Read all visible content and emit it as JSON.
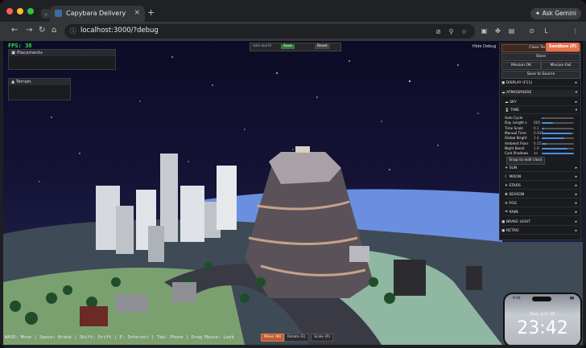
{
  "browser": {
    "tab_title": "Capybara Delivery",
    "url": "localhost:3000/?debug",
    "ask_gemini": "Ask Gemini",
    "profile_initial": "L"
  },
  "game": {
    "fps": "FPS: 38",
    "panels": {
      "placements": "Placements",
      "terrain": "Terrain"
    },
    "debug_bar": {
      "world_label": "solo world",
      "save": "Save",
      "reset": "Reset"
    },
    "hide_debug": "Hide Debug",
    "sidebar": {
      "close_terrain": "Close Terrain",
      "sandbox": "Sandbox (P)",
      "store": "Store",
      "mission_ok": "Mission OK",
      "mission_fail": "Mission Fail",
      "save_to_source": "Save to Source",
      "display": "DISPLAY (F11)",
      "atmosphere": "ATMOSPHERE",
      "sky": "SKY",
      "time": "TIME",
      "time_rows": [
        {
          "label": "Auto Cycle",
          "value": "",
          "fill": 0.05
        },
        {
          "label": "Day Length s",
          "value": "600",
          "fill": 0.35
        },
        {
          "label": "Time Scale",
          "value": "0.1",
          "fill": 0.08
        },
        {
          "label": "Manual Time",
          "value": "0.935",
          "fill": 0.93
        },
        {
          "label": "Global Bright",
          "value": "1.4",
          "fill": 0.7
        },
        {
          "label": "Ambient Floor",
          "value": "0.15",
          "fill": 0.15
        },
        {
          "label": "Night Boost",
          "value": "1.6",
          "fill": 0.8
        },
        {
          "label": "Cast Shadows",
          "value": "on",
          "fill": 1.0
        }
      ],
      "snap_clock": "Snap to wall clock",
      "sun": "SUN",
      "moon": "MOON",
      "stars": "STARS",
      "season": "SEASON",
      "fog": "FOG",
      "rain": "RAIN",
      "brake_light": "BRAKE LIGHT",
      "retro": "RETRO"
    },
    "hints": "WASD: Move | Space: Brake | Shift: Drift | E: Interact | Tab: Phone | Drag Mouse: Look",
    "modes": {
      "move": "Move (W)",
      "rotate": "Rotate (E)",
      "scale": "Scale (R)"
    },
    "phone": {
      "carrier": "9:41",
      "date": "Sun, Jun 28",
      "time": "23:42"
    }
  },
  "colors": {
    "accent_sandbox": "#e8704a",
    "fps_green": "#35e04a",
    "slider_blue": "#4a90e2"
  }
}
